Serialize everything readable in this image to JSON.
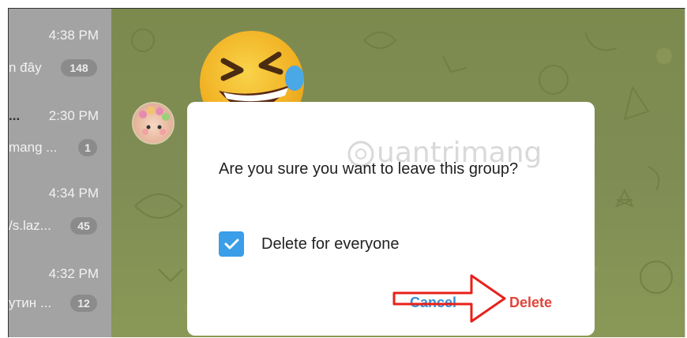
{
  "chat_list": {
    "items": [
      {
        "time": "4:38 PM",
        "title_fragment": "",
        "preview": "n đây",
        "badge": "148"
      },
      {
        "time": "2:30 PM",
        "title_fragment": "...",
        "preview": "mang ...",
        "badge": "1"
      },
      {
        "time": "4:34 PM",
        "title_fragment": "",
        "preview": "/s.laz...",
        "badge": "45"
      },
      {
        "time": "4:32 PM",
        "title_fragment": "",
        "preview": "утин ...",
        "badge": "12"
      }
    ]
  },
  "dialog": {
    "message": "Are you sure you want to leave this group?",
    "checkbox_label": "Delete for everyone",
    "checkbox_checked": true,
    "cancel_label": "Cancel",
    "delete_label": "Delete",
    "watermark": "uantrimang"
  },
  "colors": {
    "checkbox": "#3a9ee8",
    "delete": "#e0453a",
    "cancel": "#3a8fd6",
    "annotation_arrow": "#e8201a"
  }
}
